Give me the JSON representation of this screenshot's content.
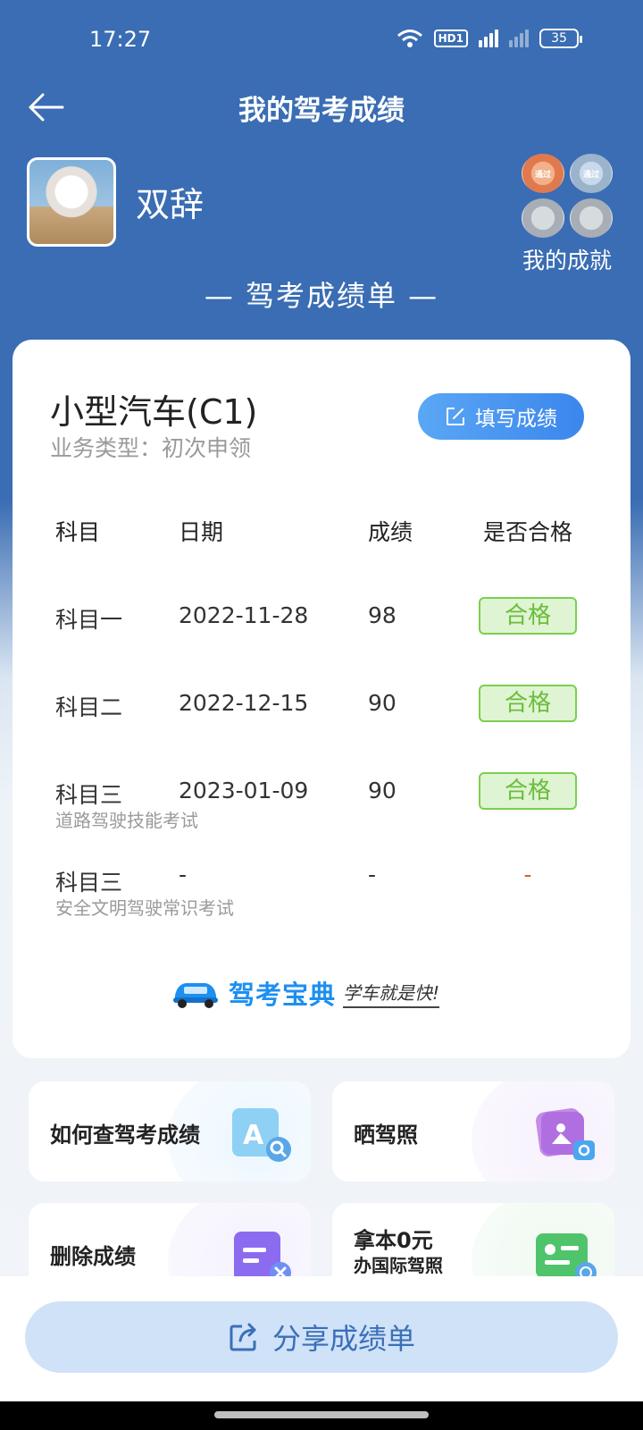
{
  "status_bar": {
    "time": "17:27",
    "battery": "35",
    "hd": "HD1",
    "network": "4G"
  },
  "header": {
    "title": "我的驾考成绩"
  },
  "profile": {
    "username": "双辞",
    "achievements_label": "我的成就",
    "badge_text": "通过"
  },
  "section_heading": "— 驾考成绩单 —",
  "card": {
    "vehicle": "小型汽车(C1)",
    "business_type": "业务类型：初次申领",
    "fill_button": "填写成绩",
    "columns": [
      "科目",
      "日期",
      "成绩",
      "是否合格"
    ],
    "rows": [
      {
        "subject": "科目一",
        "date": "2022-11-28",
        "score": "98",
        "result": "合格",
        "note": ""
      },
      {
        "subject": "科目二",
        "date": "2022-12-15",
        "score": "90",
        "result": "合格",
        "note": ""
      },
      {
        "subject": "科目三",
        "date": "2023-01-09",
        "score": "90",
        "result": "合格",
        "note": "道路驾驶技能考试"
      },
      {
        "subject": "科目三",
        "date": "-",
        "score": "-",
        "result": "-",
        "note": "安全文明驾驶常识考试"
      }
    ],
    "brand_name": "驾考宝典",
    "brand_slogan": "学车就是快!"
  },
  "tiles": {
    "query": "如何查驾考成绩",
    "show_license": "晒驾照",
    "delete": "删除成绩",
    "intl_line1": "拿本0元",
    "intl_line2": "办国际驾照"
  },
  "share_button": "分享成绩单",
  "colors": {
    "primary": "#3a6db3",
    "pass_green": "#6bbd3b",
    "accent_blue": "#1d8ff0",
    "fail_red": "#e4592f"
  }
}
